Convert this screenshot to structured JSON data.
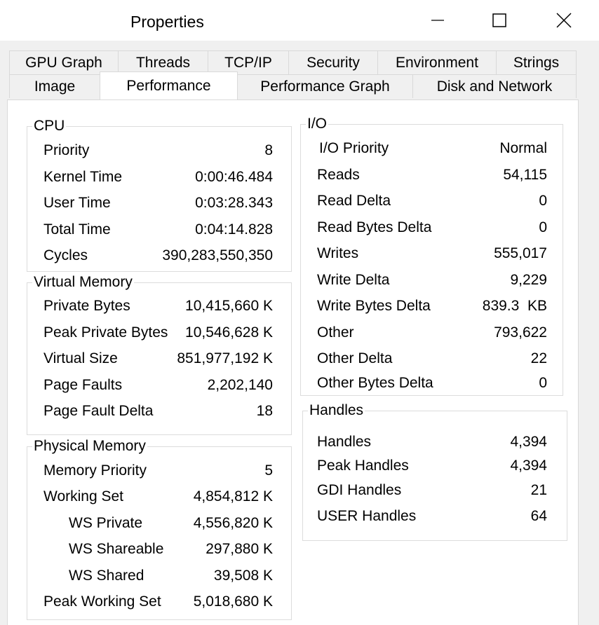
{
  "window": {
    "title": "Properties"
  },
  "tabs": {
    "back_row": [
      "GPU Graph",
      "Threads",
      "TCP/IP",
      "Security",
      "Environment",
      "Strings"
    ],
    "front_row": [
      "Image",
      "Performance",
      "Performance Graph",
      "Disk and Network"
    ],
    "active": "Performance"
  },
  "cpu": {
    "title": "CPU",
    "rows": [
      {
        "label": "Priority",
        "value": "8"
      },
      {
        "label": "Kernel Time",
        "value": "0:00:46.484"
      },
      {
        "label": "User Time",
        "value": "0:03:28.343"
      },
      {
        "label": "Total Time",
        "value": "0:04:14.828"
      },
      {
        "label": "Cycles",
        "value": "390,283,550,350"
      }
    ]
  },
  "virtual_memory": {
    "title": "Virtual Memory",
    "rows": [
      {
        "label": "Private Bytes",
        "value": "10,415,660 K"
      },
      {
        "label": "Peak Private Bytes",
        "value": "10,546,628 K"
      },
      {
        "label": "Virtual Size",
        "value": "851,977,192 K"
      },
      {
        "label": "Page Faults",
        "value": "2,202,140"
      },
      {
        "label": "Page Fault Delta",
        "value": "18"
      }
    ]
  },
  "physical_memory": {
    "title": "Physical Memory",
    "rows": [
      {
        "label": "Memory Priority",
        "value": "5"
      },
      {
        "label": "Working Set",
        "value": "4,854,812 K"
      },
      {
        "label": "WS Private",
        "value": "4,556,820 K"
      },
      {
        "label": "WS Shareable",
        "value": "297,880 K"
      },
      {
        "label": "WS Shared",
        "value": "39,508 K"
      },
      {
        "label": "Peak Working Set",
        "value": "5,018,680 K"
      }
    ]
  },
  "io": {
    "title": "I/O",
    "rows": [
      {
        "label": "I/O Priority",
        "value": "Normal"
      },
      {
        "label": "Reads",
        "value": "54,115"
      },
      {
        "label": "Read Delta",
        "value": "0"
      },
      {
        "label": "Read Bytes Delta",
        "value": "0"
      },
      {
        "label": "Writes",
        "value": "555,017"
      },
      {
        "label": "Write Delta",
        "value": "9,229"
      },
      {
        "label": "Write Bytes Delta",
        "value": "839.3  KB"
      },
      {
        "label": "Other",
        "value": "793,622"
      },
      {
        "label": "Other Delta",
        "value": "22"
      },
      {
        "label": "Other Bytes Delta",
        "value": "0"
      }
    ]
  },
  "handles": {
    "title": "Handles",
    "rows": [
      {
        "label": "Handles",
        "value": "4,394"
      },
      {
        "label": "Peak Handles",
        "value": "4,394"
      },
      {
        "label": "GDI Handles",
        "value": "21"
      },
      {
        "label": "USER Handles",
        "value": "64"
      }
    ]
  }
}
